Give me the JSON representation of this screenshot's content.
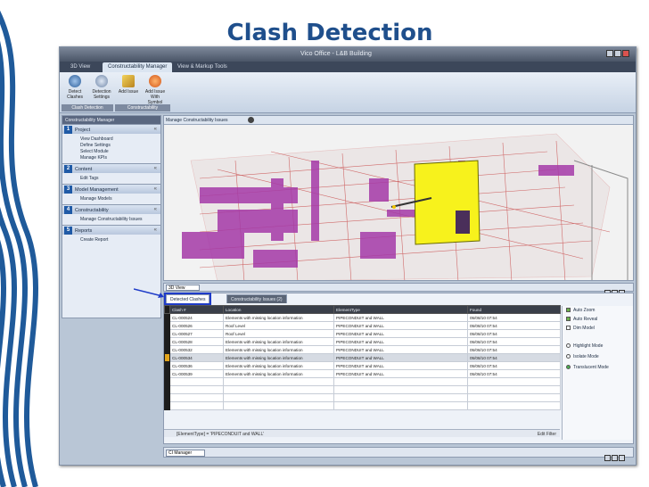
{
  "slide": {
    "title": "Clash Detection"
  },
  "app": {
    "window_title": "Vico Office - L&B Building",
    "tabs": [
      "3D View",
      "Constructability Manager",
      "View & Markup Tools"
    ],
    "ribbon": {
      "buttons": [
        {
          "label": "Detect Clashes",
          "icon": "detect-clashes-icon"
        },
        {
          "label": "Detection Settings",
          "icon": "settings-icon"
        },
        {
          "label": "Add Issue",
          "icon": "add-issue-icon"
        },
        {
          "label": "Add Issue With Symbol",
          "icon": "pin-icon"
        }
      ],
      "groups": [
        "Clash Detection",
        "Constructability"
      ]
    },
    "left_panel": {
      "title": "Constructability Manager",
      "sections": [
        {
          "num": "1",
          "title": "Project",
          "items": [
            "View Dashboard",
            "Define Settings",
            "Select Module",
            "Manage KPIs"
          ]
        },
        {
          "num": "2",
          "title": "Content",
          "items": [
            "Edit Tags"
          ]
        },
        {
          "num": "3",
          "title": "Model Management",
          "items": [
            "Manage Models"
          ]
        },
        {
          "num": "4",
          "title": "Constructability",
          "items": [
            "Manage Constructability Issues"
          ]
        },
        {
          "num": "5",
          "title": "Reports",
          "items": [
            "Create Report"
          ]
        }
      ]
    },
    "viewport": {
      "tab_label": "Manage Constructability Issues",
      "view_mode": "3D View"
    },
    "results": {
      "tabs": [
        "Detected Clashes",
        "Constructability Issues (2)"
      ],
      "columns": [
        "Clash #",
        "Location",
        "ElementType",
        "Found"
      ],
      "rows": [
        {
          "id": "CL-000524",
          "location": "Elements with missing location information",
          "type": "PIPECONDUIT and WALL",
          "found": "05/08/10 07:54"
        },
        {
          "id": "CL-000526",
          "location": "Roof Level",
          "type": "PIPECONDUIT and WALL",
          "found": "05/08/10 07:54"
        },
        {
          "id": "CL-000527",
          "location": "Roof Level",
          "type": "PIPECONDUIT and WALL",
          "found": "05/08/10 07:54"
        },
        {
          "id": "CL-000528",
          "location": "Elements with missing location information",
          "type": "PIPECONDUIT and WALL",
          "found": "05/08/10 07:54"
        },
        {
          "id": "CL-000532",
          "location": "Elements with missing location information",
          "type": "PIPECONDUIT and WALL",
          "found": "05/08/10 07:54"
        },
        {
          "id": "CL-000534",
          "location": "Elements with missing location information",
          "type": "PIPECONDUIT and WALL",
          "found": "05/08/10 07:54"
        },
        {
          "id": "CL-000536",
          "location": "Elements with missing location information",
          "type": "PIPECONDUIT and WALL",
          "found": "05/08/10 07:54"
        },
        {
          "id": "CL-000539",
          "location": "Elements with missing location information",
          "type": "PIPECONDUIT and WALL",
          "found": "05/08/10 07:54"
        }
      ],
      "filter_text": "[ElementType] = 'PIPECONDUIT and WALL'",
      "edit_filter": "Edit Filter",
      "options": {
        "checkboxes": [
          {
            "label": "Auto Zoom",
            "checked": true
          },
          {
            "label": "Auto Reveal",
            "checked": true
          },
          {
            "label": "Dim Model",
            "checked": false
          }
        ],
        "modes": [
          {
            "label": "Highlight Mode",
            "selected": false
          },
          {
            "label": "Isolate Mode",
            "selected": false
          },
          {
            "label": "Translucent Mode",
            "selected": true
          }
        ]
      }
    },
    "bottom": {
      "manager_select": "CI Manager"
    },
    "colors": {
      "title_blue": "#1f4f8c",
      "highlight_border": "#1f3cc8",
      "clash_yellow": "#f7f21c",
      "pipe_magenta": "#c23cc0"
    }
  }
}
